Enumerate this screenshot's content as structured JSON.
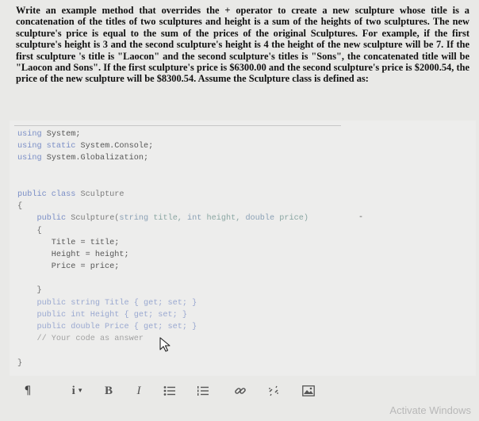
{
  "question": "Write an example method that overrides the + operator to create a new sculpture whose title is a concatenation of the titles of two sculptures and height is a sum of the heights of two sculptures. The new sculpture's price is equal to the sum of the prices of the original Sculptures. For example, if the first sculpture's height is 3 and the second sculpture's height is 4 the height of the new sculpture will be 7. If the first sculpture 's title is \"Laocon\" and the second sculpture's titles is \"Sons\", the concatenated title will be \"Laocon and Sons\". If the first sculpture's price is $6300.00 and the second sculpture's price is $2000.54, the price of the new sculpture will be $8300.54. Assume the Sculpture class is defined as:",
  "code": {
    "using1": {
      "kw": "using",
      "rest": "System;"
    },
    "using2": {
      "kw": "using static",
      "rest": "System.Console;"
    },
    "using3": {
      "kw": "using",
      "rest": "System.Globalization;"
    },
    "class_kw": "public class",
    "class_name": "Sculpture",
    "brace_open": "{",
    "brace_close": "}",
    "ctor_kw": "public",
    "ctor_name": "Sculpture(",
    "param1_type": "string",
    "param1_name": "title,",
    "param2_type": "int",
    "param2_name": "height,",
    "param3_type": "double",
    "param3_name": "price)",
    "assign1": "Title = title;",
    "assign2": "Height = height;",
    "assign3": "Price = price;",
    "prop1": "public string Title { get; set; }",
    "prop2": "public int Height { get; set; }",
    "prop3": "public double Price { get; set; }",
    "comment": "// Your code as answer"
  },
  "toolbar": {
    "paragraph_label": "¶",
    "info_label": "i",
    "bold_label": "B",
    "italic_label": "I"
  },
  "watermark": "Activate Windows"
}
